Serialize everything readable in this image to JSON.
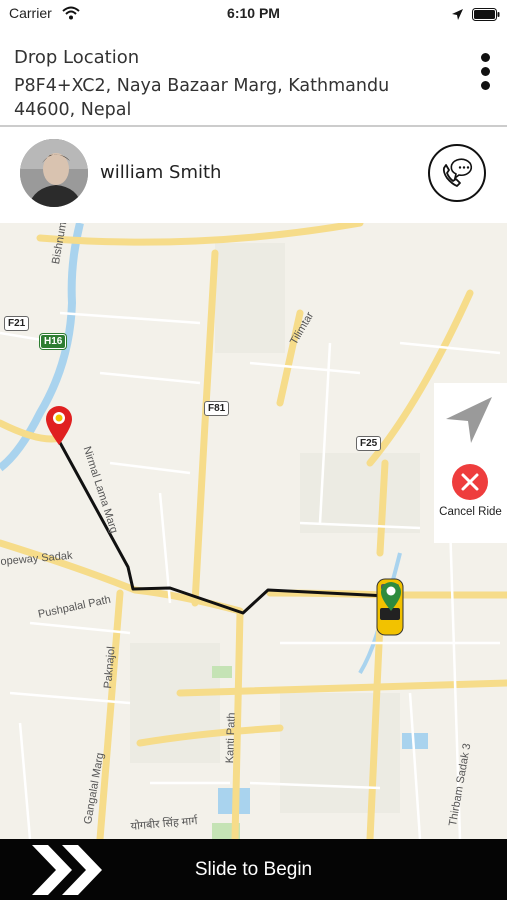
{
  "status_bar": {
    "carrier": "Carrier",
    "time": "6:10 PM"
  },
  "drop": {
    "title": "Drop Location",
    "address": "P8F4+XC2, Naya Bazaar Marg, Kathmandu 44600, Nepal"
  },
  "driver": {
    "name": "william Smith"
  },
  "map": {
    "labels": {
      "bishnumati": "Bishnumati",
      "tilimtar": "Tilimtar",
      "nirmal_lama_marg": "Nirmal Lama Marg",
      "ropeway_sadak": "opeway Sadak",
      "pushpalal_path": "Pushpalal Path",
      "paknajol": "Paknajol",
      "kanti_path": "Kanti Path",
      "gangalal_marg": "Gangalal Marg",
      "thirbam_sadak": "Thirbam Sadak 3",
      "yogbir_marg": "योगबीर सिंह मार्ग"
    },
    "badges": {
      "f21": "F21",
      "h16": "H16",
      "f81": "F81",
      "f25": "F25"
    },
    "route_color": "#111111",
    "pin_color": "#e02020",
    "taxi_color": "#f2c200"
  },
  "side_panel": {
    "cancel_label": "Cancel Ride"
  },
  "slide": {
    "label": "Slide to Begin"
  },
  "colors": {
    "accent_red": "#ee3d3d",
    "bar_bg": "#050505"
  }
}
